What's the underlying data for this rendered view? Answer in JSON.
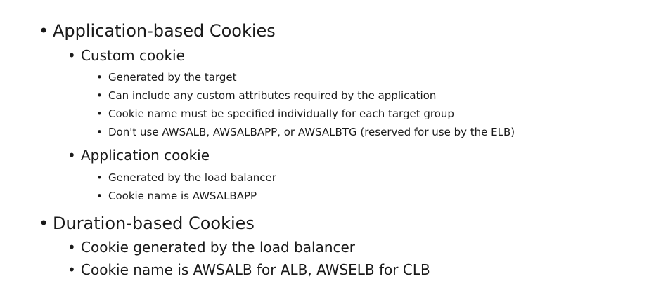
{
  "bullet_glyph": "•",
  "sections": [
    {
      "label": "Application-based Cookies",
      "children": [
        {
          "label": "Custom cookie",
          "items": [
            "Generated by the target",
            "Can include any custom attributes required by the application",
            "Cookie name must be specified individually for each target group",
            "Don't use AWSALB, AWSALBAPP, or AWSALBTG (reserved for use by the ELB)"
          ]
        },
        {
          "label": "Application cookie",
          "items": [
            "Generated by the load balancer",
            "Cookie name is AWSALBAPP"
          ]
        }
      ]
    },
    {
      "label": "Duration-based Cookies",
      "points": [
        "Cookie generated by the load balancer",
        "Cookie name is AWSALB for ALB, AWSELB for CLB"
      ]
    }
  ]
}
